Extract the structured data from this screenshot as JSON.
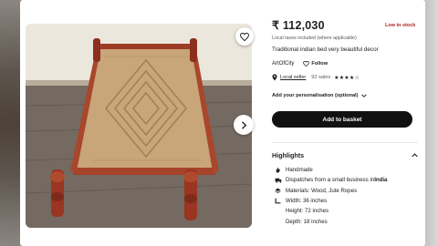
{
  "product": {
    "price": "₹ 112,030",
    "stock_status": "Low in stock",
    "tax_note": "Local taxes included (where applicable)",
    "title": "Traditional indian bed very beautiful decor"
  },
  "shop": {
    "name": "ArtOfCity",
    "follow_label": "Follow",
    "local_seller_label": "Local seller",
    "sales": "92 sales",
    "stars": "★★★★☆",
    "rating": 4
  },
  "personalisation_label": "Add your personalisation (optional)",
  "basket_label": "Add to basket",
  "highlights": {
    "heading": "Highlights",
    "items": [
      {
        "icon": "hand-icon",
        "text": "Handmade"
      },
      {
        "icon": "truck-icon",
        "text": "Dispatches from a small business in ",
        "bold": "India"
      },
      {
        "icon": "layers-icon",
        "text": "Materials: Wood, Jute Ropes"
      },
      {
        "icon": "ruler-icon",
        "text": "Width: 36 inches"
      },
      {
        "icon": "ruler-icon",
        "text": "Height: 72 inches"
      },
      {
        "icon": "ruler-icon",
        "text": "Depth: 18 inches"
      }
    ]
  },
  "colors": {
    "stock_red": "#b3261e",
    "button_black": "#111111"
  }
}
